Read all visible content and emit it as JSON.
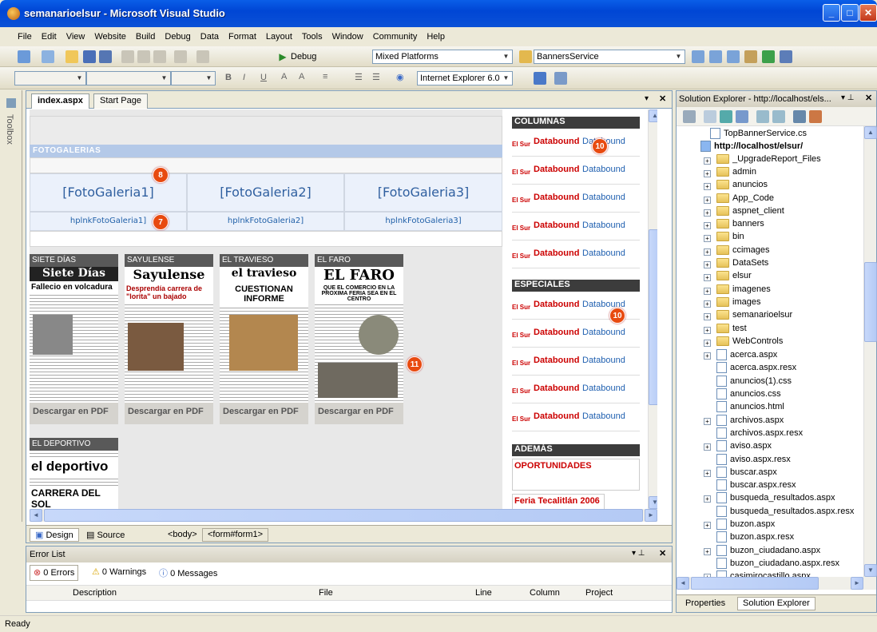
{
  "window": {
    "title": "semanarioelsur - Microsoft Visual Studio"
  },
  "menu": [
    "File",
    "Edit",
    "View",
    "Website",
    "Build",
    "Debug",
    "Data",
    "Format",
    "Layout",
    "Tools",
    "Window",
    "Community",
    "Help"
  ],
  "toolbar1": {
    "config": "Debug",
    "platform": "Mixed Platforms",
    "project": "BannersService"
  },
  "toolbar2": {
    "target": "Internet Explorer 6.0"
  },
  "toolbox": {
    "label": "Toolbox"
  },
  "doc_tabs": [
    "index.aspx",
    "Start Page"
  ],
  "design": {
    "fotogalerias_header": "FOTOGALERIAS",
    "gallery_cells": [
      "[FotoGaleria1]",
      "[FotoGaleria2]",
      "[FotoGaleria3]"
    ],
    "gallery_links": [
      "hplnkFotoGaleria1]",
      "hplnkFotoGaleria2]",
      "hplnkFotoGaleria3]"
    ],
    "badges": [
      "8",
      "7",
      "10",
      "10",
      "11"
    ],
    "papers": [
      {
        "label": "SIETE DÍAS",
        "masthead": "Siete Días",
        "headline": "Fallecio en volcadura",
        "pdf": "Descargar en PDF"
      },
      {
        "label": "SAYULENSE",
        "masthead": "Sayulense",
        "headline": "Desprendía carrera de \"lorita\" un bajado",
        "pdf": "Descargar en PDF"
      },
      {
        "label": "EL TRAVIESO",
        "masthead": "el travieso",
        "headline": "CUESTIONAN INFORME",
        "pdf": "Descargar en PDF"
      },
      {
        "label": "EL FARO",
        "masthead": "EL FARO",
        "headline": "QUE EL COMERCIO EN LA PROXIMA FERIA SEA EN EL CENTRO",
        "pdf": "Descargar en PDF"
      }
    ],
    "deportivo": {
      "label": "EL DEPORTIVO",
      "masthead": "el deportivo",
      "headline": "CARRERA DEL SOL"
    },
    "right": {
      "columnas": "COLUMNAS",
      "especiales": "ESPECIALES",
      "ademas": "ADEMÁS",
      "oportunidades": "OPORTUNIDADES",
      "feria": "Feria Tecalitlán 2006",
      "elsur": "El Sur",
      "databound_bold": "Databound",
      "databound": "Databound"
    }
  },
  "design_bar": {
    "design": "Design",
    "source": "Source",
    "tags": [
      "<body>",
      "<form#form1>"
    ]
  },
  "errorlist": {
    "title": "Error List",
    "errors": "0 Errors",
    "warnings": "0 Warnings",
    "messages": "0 Messages",
    "columns": [
      "Description",
      "File",
      "Line",
      "Column",
      "Project"
    ]
  },
  "solution": {
    "title": "Solution Explorer - http://localhost/els...",
    "items": [
      {
        "label": "TopBannerService.cs",
        "kind": "file"
      },
      {
        "label": "http://localhost/elsur/",
        "kind": "root"
      },
      {
        "label": "_UpgradeReport_Files",
        "kind": "folder"
      },
      {
        "label": "admin",
        "kind": "folder"
      },
      {
        "label": "anuncios",
        "kind": "folder"
      },
      {
        "label": "App_Code",
        "kind": "folder"
      },
      {
        "label": "aspnet_client",
        "kind": "folder"
      },
      {
        "label": "banners",
        "kind": "folder"
      },
      {
        "label": "bin",
        "kind": "folder"
      },
      {
        "label": "ccimages",
        "kind": "folder"
      },
      {
        "label": "DataSets",
        "kind": "folder"
      },
      {
        "label": "elsur",
        "kind": "folder"
      },
      {
        "label": "imagenes",
        "kind": "folder"
      },
      {
        "label": "images",
        "kind": "folder"
      },
      {
        "label": "semanarioelsur",
        "kind": "folder"
      },
      {
        "label": "test",
        "kind": "folder"
      },
      {
        "label": "WebControls",
        "kind": "folder"
      },
      {
        "label": "acerca.aspx",
        "kind": "file"
      },
      {
        "label": "acerca.aspx.resx",
        "kind": "file"
      },
      {
        "label": "anuncios(1).css",
        "kind": "file"
      },
      {
        "label": "anuncios.css",
        "kind": "file"
      },
      {
        "label": "anuncios.html",
        "kind": "file"
      },
      {
        "label": "archivos.aspx",
        "kind": "file"
      },
      {
        "label": "archivos.aspx.resx",
        "kind": "file"
      },
      {
        "label": "aviso.aspx",
        "kind": "file"
      },
      {
        "label": "aviso.aspx.resx",
        "kind": "file"
      },
      {
        "label": "buscar.aspx",
        "kind": "file"
      },
      {
        "label": "buscar.aspx.resx",
        "kind": "file"
      },
      {
        "label": "busqueda_resultados.aspx",
        "kind": "file"
      },
      {
        "label": "busqueda_resultados.aspx.resx",
        "kind": "file"
      },
      {
        "label": "buzon.aspx",
        "kind": "file"
      },
      {
        "label": "buzon.aspx.resx",
        "kind": "file"
      },
      {
        "label": "buzon_ciudadano.aspx",
        "kind": "file"
      },
      {
        "label": "buzon_ciudadano.aspx.resx",
        "kind": "file"
      },
      {
        "label": "casimirocastillo.aspx",
        "kind": "file"
      }
    ],
    "tabs": [
      "Properties",
      "Solution Explorer"
    ]
  },
  "status": "Ready"
}
